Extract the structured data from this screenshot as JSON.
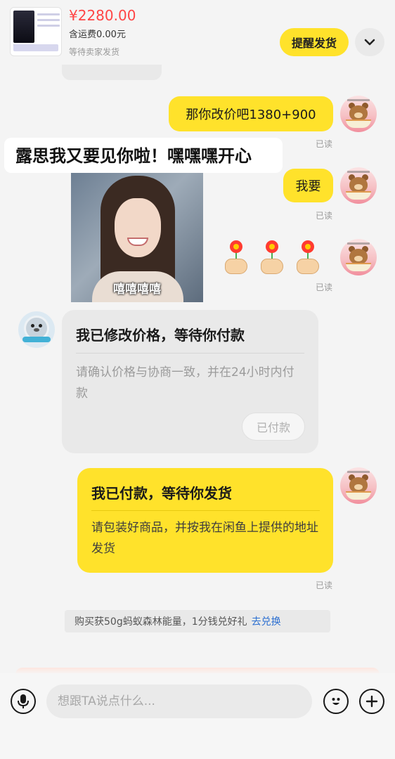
{
  "header": {
    "price": "¥2280.00",
    "shipping": "含运费0.00元",
    "status": "等待卖家发货",
    "remind_button": "提醒发货",
    "expand_icon": "chevron-down-icon"
  },
  "messages": [
    {
      "side": "right",
      "type": "text",
      "text": "那你改价吧1380+900",
      "read": "已读"
    },
    {
      "side": "left",
      "type": "sticker",
      "text": "露思我又要见你啦！嘿嘿嘿开心",
      "caption": "嘻嘻嘻嘻"
    },
    {
      "side": "right",
      "type": "text",
      "text": "我要",
      "read": "已读"
    },
    {
      "side": "right",
      "type": "emoji",
      "emoji": "flower-in-hand ×3",
      "read": "已读"
    },
    {
      "side": "left",
      "type": "card",
      "title": "我已修改价格，等待你付款",
      "body": "请确认价格与协商一致，并在24小时内付款",
      "button": "已付款"
    },
    {
      "side": "right",
      "type": "card",
      "title": "我已付款，等待你发货",
      "body": "请包装好商品，并按我在闲鱼上提供的地址发货",
      "read": "已读"
    }
  ],
  "promo": {
    "text": "购买获50g蚂蚁森林能量，1分钱兑好礼",
    "link": "去兑换"
  },
  "input": {
    "placeholder": "想跟TA说点什么..."
  },
  "colors": {
    "accent_yellow": "#ffe22b",
    "price_red": "#ff4545",
    "link_blue": "#2c6fd1",
    "background": "#f4f4f4"
  }
}
